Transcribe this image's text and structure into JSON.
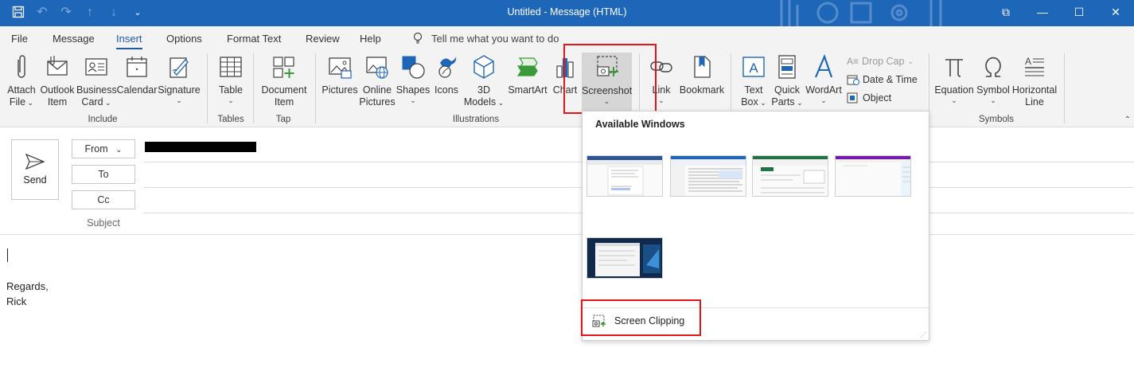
{
  "window": {
    "title": "Untitled  -  Message (HTML)",
    "controls": [
      "⧉",
      "—",
      "☐",
      "✕"
    ]
  },
  "menu": {
    "tabs": [
      "File",
      "Message",
      "Insert",
      "Options",
      "Format Text",
      "Review",
      "Help"
    ],
    "active_tab": "Insert",
    "tell_me": "Tell me what you want to do"
  },
  "ribbon": {
    "groups": {
      "include": "Include",
      "tables": "Tables",
      "tap": "Tap",
      "illustrations": "Illustrations",
      "symbols": "Symbols"
    },
    "buttons": {
      "attach_file": [
        "Attach",
        "File"
      ],
      "outlook_item": [
        "Outlook",
        "Item"
      ],
      "business_card": [
        "Business",
        "Card"
      ],
      "calendar": "Calendar",
      "signature": "Signature",
      "table": "Table",
      "document_item": [
        "Document",
        "Item"
      ],
      "pictures": "Pictures",
      "online_pictures": [
        "Online",
        "Pictures"
      ],
      "shapes": "Shapes",
      "icons": "Icons",
      "models_3d": [
        "3D",
        "Models"
      ],
      "smartart": "SmartArt",
      "chart": "Chart",
      "screenshot": "Screenshot",
      "link": "Link",
      "bookmark": "Bookmark",
      "text_box": [
        "Text",
        "Box"
      ],
      "quick_parts": [
        "Quick",
        "Parts"
      ],
      "wordart": "WordArt",
      "drop_cap": "Drop Cap",
      "date_time": "Date & Time",
      "object": "Object",
      "equation": "Equation",
      "symbol": "Symbol",
      "horizontal_line": [
        "Horizontal",
        "Line"
      ]
    }
  },
  "compose": {
    "send": "Send",
    "from": "From",
    "to": "To",
    "cc": "Cc",
    "subject": "Subject",
    "body_lines": [
      "Regards,",
      "Rick"
    ]
  },
  "screenshot_menu": {
    "heading": "Available Windows",
    "clipping": "Screen Clipping"
  },
  "colors": {
    "title_bar": "#1e66b8",
    "accent": "#1e5aa8",
    "highlight": "#e2141c"
  }
}
